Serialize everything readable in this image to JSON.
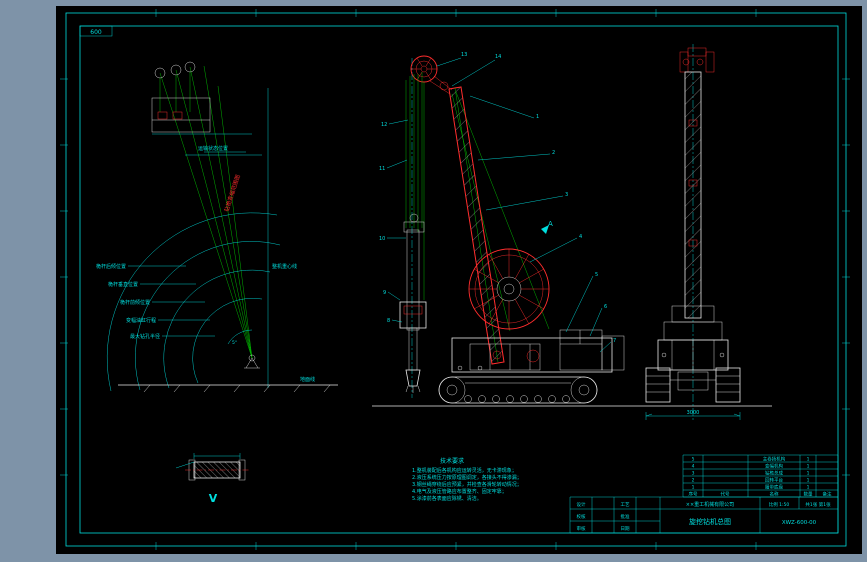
{
  "colors": {
    "background": "#7e93a8",
    "paper": "#000000",
    "line_cyan": "#00dede",
    "line_green": "#00c400",
    "line_red": "#ff2d2d",
    "line_white": "#e8e8e8"
  },
  "frame": {
    "corner_label": "600"
  },
  "left_view": {
    "title": "钻桅变幅范围图",
    "angle_label": "5°",
    "transport_label": "运输状态位置",
    "labels": [
      "桅杆后倾位置",
      "桅杆垂直位置",
      "桅杆前倾位置",
      "变幅油缸行程",
      "最大钻孔半径",
      "整机重心线",
      "地面线"
    ]
  },
  "center_view": {
    "section_label": "A",
    "callouts": [
      "1",
      "2",
      "3",
      "4",
      "5",
      "6",
      "7",
      "8",
      "9",
      "10",
      "11",
      "12",
      "13",
      "14"
    ]
  },
  "right_view": {
    "track_dim": "3000"
  },
  "detail_view": {
    "label": "V"
  },
  "notes": {
    "title": "技术要求",
    "lines": [
      "1.整机装配后各机构应运转灵活，无卡滞现象；",
      "2.液压系统压力按原理图调定，各接头不得渗漏；",
      "3.钢丝绳穿绕后应预紧，并检查各滑轮转动情况；",
      "4.电气及液压管路应布置整齐、固定牢靠；",
      "5.涂漆前各表面应除锈、清洁。"
    ]
  },
  "bom": {
    "headers": [
      "序号",
      "代号",
      "名称",
      "数量",
      "备注"
    ],
    "rows": [
      [
        "5",
        "",
        "主卷扬机构",
        "1",
        ""
      ],
      [
        "4",
        "",
        "变幅机构",
        "1",
        ""
      ],
      [
        "3",
        "",
        "钻桅总成",
        "1",
        ""
      ],
      [
        "2",
        "",
        "回转平台",
        "1",
        ""
      ],
      [
        "1",
        "",
        "履带底盘",
        "1",
        ""
      ]
    ]
  },
  "title_block": {
    "fields": [
      "设计",
      "校核",
      "审核",
      "工艺",
      "批准",
      "日期"
    ],
    "company": "××重工机械有限公司",
    "name": "旋挖钻机总图",
    "no": "XWZ-600-00",
    "scale_text": "比例 1:50",
    "sheet": "共1张 第1张"
  }
}
